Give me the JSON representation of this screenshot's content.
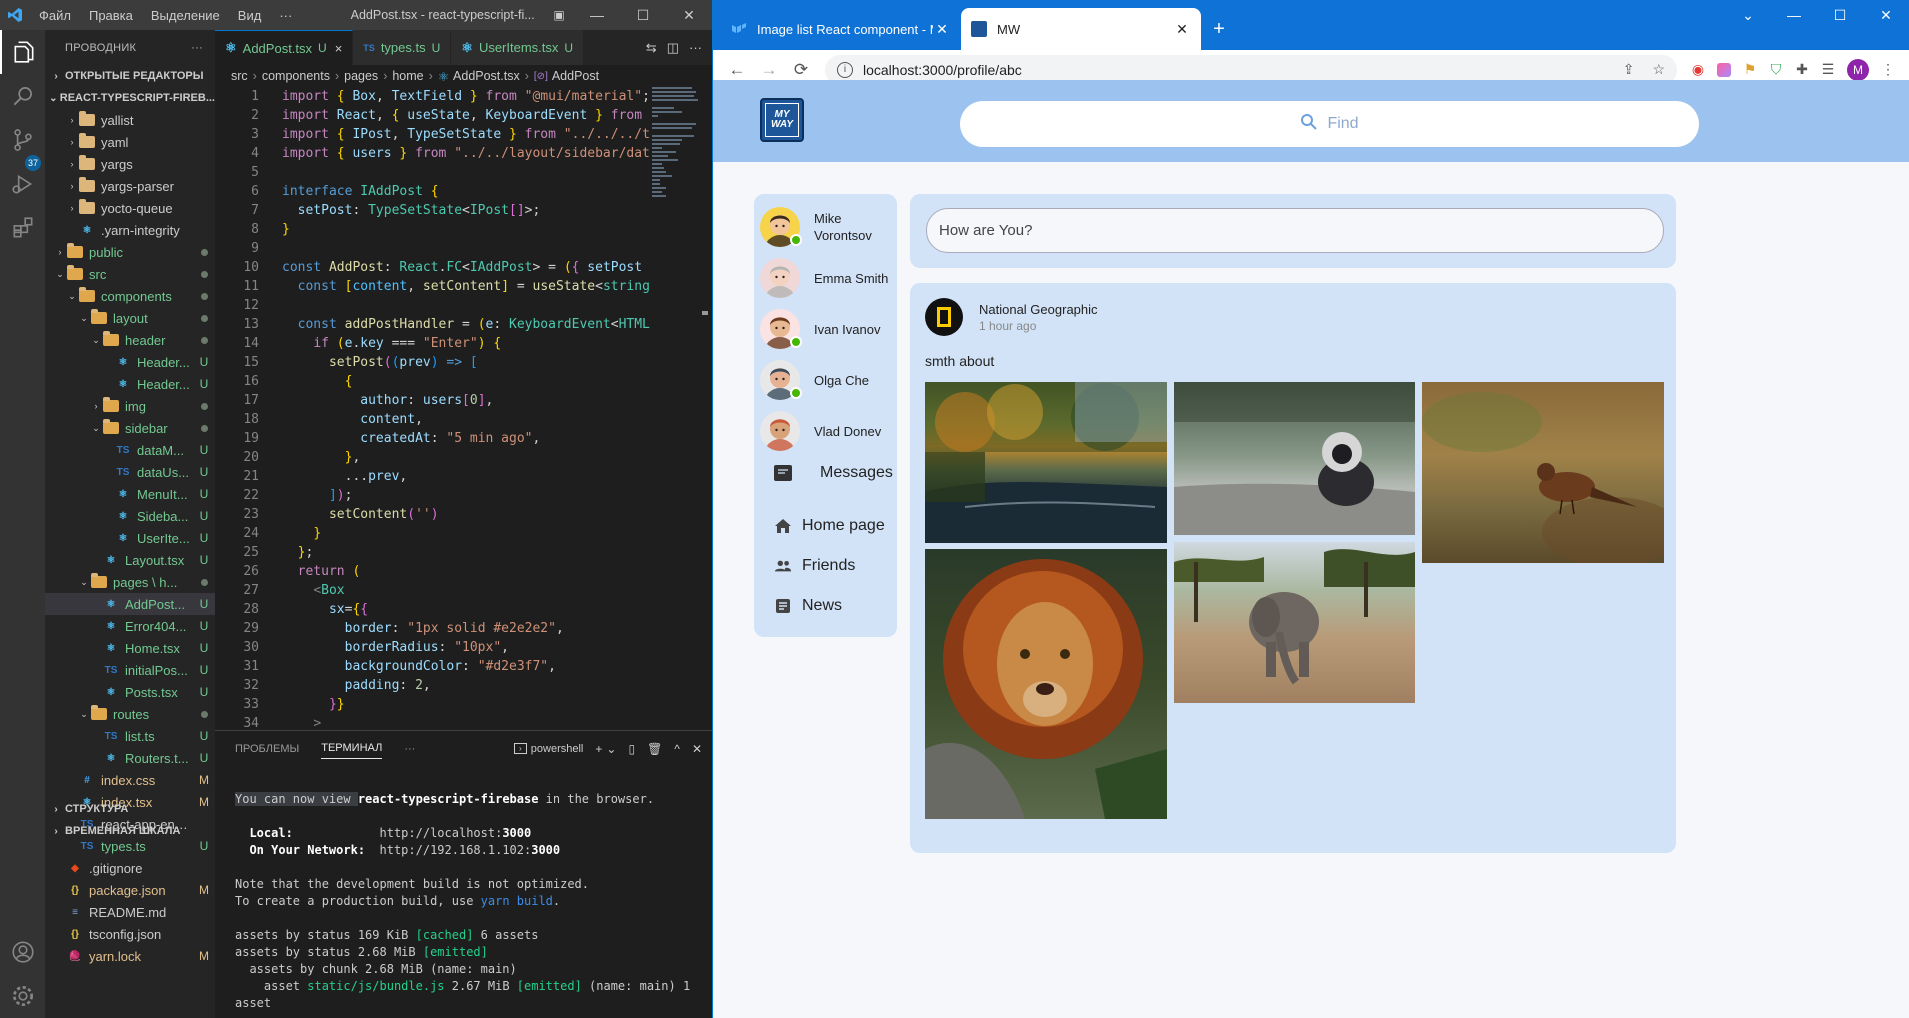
{
  "vscode": {
    "menu": [
      "Файл",
      "Правка",
      "Выделение",
      "Вид",
      "···"
    ],
    "window_title": "AddPost.tsx - react-typescript-fi...",
    "window_buttons": [
      "—",
      "☐",
      "✕"
    ],
    "activity": {
      "scm_badge": "37"
    },
    "explorer": {
      "title": "ПРОВОДНИК",
      "more": "···",
      "open_editors": "ОТКРЫТЫЕ РЕДАКТОРЫ",
      "project": "REACT-TYPESCRIPT-FIREB...",
      "outline": "СТРУКТУРА",
      "timeline": "ВРЕМЕННАЯ ШКАЛА",
      "tree": [
        {
          "name": "yallist",
          "type": "folder",
          "indent": 1,
          "color": "#ccc",
          "status": ""
        },
        {
          "name": "yaml",
          "type": "folder",
          "indent": 1,
          "color": "#ccc",
          "status": ""
        },
        {
          "name": "yargs",
          "type": "folder",
          "indent": 1,
          "color": "#ccc",
          "status": ""
        },
        {
          "name": "yargs-parser",
          "type": "folder",
          "indent": 1,
          "color": "#ccc",
          "status": ""
        },
        {
          "name": "yocto-queue",
          "type": "folder",
          "indent": 1,
          "color": "#ccc",
          "status": ""
        },
        {
          "name": ".yarn-integrity",
          "type": "file",
          "indent": 1,
          "color": "#ccc",
          "status": ""
        },
        {
          "name": "public",
          "type": "folder",
          "indent": 0,
          "color": "#73c991",
          "status": "dot"
        },
        {
          "name": "src",
          "type": "folder",
          "indent": 0,
          "color": "#73c991",
          "status": "dot",
          "open": true
        },
        {
          "name": "components",
          "type": "folder",
          "indent": 1,
          "color": "#73c991",
          "status": "dot",
          "open": true
        },
        {
          "name": "layout",
          "type": "folder",
          "indent": 2,
          "color": "#73c991",
          "status": "dot",
          "open": true
        },
        {
          "name": "header",
          "type": "folder",
          "indent": 3,
          "color": "#73c991",
          "status": "dot",
          "open": true
        },
        {
          "name": "Header...",
          "type": "file",
          "indent": 4,
          "color": "#73c991",
          "status": "U"
        },
        {
          "name": "Header...",
          "type": "file",
          "indent": 4,
          "color": "#73c991",
          "status": "U"
        },
        {
          "name": "img",
          "type": "folder",
          "indent": 3,
          "color": "#73c991",
          "status": "dot"
        },
        {
          "name": "sidebar",
          "type": "folder",
          "indent": 3,
          "color": "#73c991",
          "status": "dot",
          "open": true
        },
        {
          "name": "dataM...",
          "type": "ts",
          "indent": 4,
          "color": "#73c991",
          "status": "U"
        },
        {
          "name": "dataUs...",
          "type": "ts",
          "indent": 4,
          "color": "#73c991",
          "status": "U"
        },
        {
          "name": "MenuIt...",
          "type": "file",
          "indent": 4,
          "color": "#73c991",
          "status": "U"
        },
        {
          "name": "Sideba...",
          "type": "file",
          "indent": 4,
          "color": "#73c991",
          "status": "U"
        },
        {
          "name": "UserIte...",
          "type": "file",
          "indent": 4,
          "color": "#73c991",
          "status": "U"
        },
        {
          "name": "Layout.tsx",
          "type": "file",
          "indent": 3,
          "color": "#73c991",
          "status": "U"
        },
        {
          "name": "pages \\ h...",
          "type": "folder",
          "indent": 2,
          "color": "#73c991",
          "status": "dot",
          "open": true
        },
        {
          "name": "AddPost...",
          "type": "file",
          "indent": 3,
          "color": "#73c991",
          "status": "U",
          "selected": true
        },
        {
          "name": "Error404...",
          "type": "file",
          "indent": 3,
          "color": "#73c991",
          "status": "U"
        },
        {
          "name": "Home.tsx",
          "type": "file",
          "indent": 3,
          "color": "#73c991",
          "status": "U"
        },
        {
          "name": "initialPos...",
          "type": "ts",
          "indent": 3,
          "color": "#73c991",
          "status": "U"
        },
        {
          "name": "Posts.tsx",
          "type": "file",
          "indent": 3,
          "color": "#73c991",
          "status": "U"
        },
        {
          "name": "routes",
          "type": "folder",
          "indent": 2,
          "color": "#73c991",
          "status": "dot",
          "open": true
        },
        {
          "name": "list.ts",
          "type": "ts",
          "indent": 3,
          "color": "#73c991",
          "status": "U"
        },
        {
          "name": "Routers.t...",
          "type": "file",
          "indent": 3,
          "color": "#73c991",
          "status": "U"
        },
        {
          "name": "index.css",
          "type": "css",
          "indent": 1,
          "color": "#e2c08d",
          "status": "M"
        },
        {
          "name": "index.tsx",
          "type": "file",
          "indent": 1,
          "color": "#e2c08d",
          "status": "M"
        },
        {
          "name": "react-app-env.d.ts",
          "type": "ts",
          "indent": 1,
          "color": "#ccc",
          "status": ""
        },
        {
          "name": "types.ts",
          "type": "ts",
          "indent": 1,
          "color": "#73c991",
          "status": "U"
        },
        {
          "name": ".gitignore",
          "type": "git",
          "indent": 0,
          "color": "#ccc",
          "status": ""
        },
        {
          "name": "package.json",
          "type": "json",
          "indent": 0,
          "color": "#e2c08d",
          "status": "M"
        },
        {
          "name": "README.md",
          "type": "md",
          "indent": 0,
          "color": "#ccc",
          "status": ""
        },
        {
          "name": "tsconfig.json",
          "type": "json",
          "indent": 0,
          "color": "#ccc",
          "status": ""
        },
        {
          "name": "yarn.lock",
          "type": "yarn",
          "indent": 0,
          "color": "#e2c08d",
          "status": "M"
        }
      ]
    },
    "tabs": [
      {
        "icon": "react",
        "name": "AddPost.tsx",
        "status": "U",
        "close": "×",
        "active": true
      },
      {
        "icon": "TS",
        "name": "types.ts",
        "status": "U",
        "close": "",
        "active": false
      },
      {
        "icon": "react",
        "name": "UserItems.tsx",
        "status": "U",
        "close": "",
        "active": false
      }
    ],
    "breadcrumb": [
      "src",
      "components",
      "pages",
      "home",
      "AddPost.tsx",
      "AddPost"
    ],
    "breadcrumb_sym": "[⊘]",
    "code_lines": [
      {
        "n": "1",
        "html": "<span class='kw'>import</span> <span class='br1'>{</span> <span class='vr'>Box</span>, <span class='vr'>TextField</span> <span class='br1'>}</span> <span class='kw'>from</span> <span class='str'>\"@mui/material\"</span>;"
      },
      {
        "n": "2",
        "html": "<span class='kw'>import</span> <span class='vr'>React</span>, <span class='br1'>{</span> <span class='vr'>useState</span>, <span class='vr'>KeyboardEvent</span> <span class='br1'>}</span> <span class='kw'>from</span>"
      },
      {
        "n": "3",
        "html": "<span class='kw'>import</span> <span class='br1'>{</span> <span class='vr'>IPost</span>, <span class='vr'>TypeSetState</span> <span class='br1'>}</span> <span class='kw'>from</span> <span class='str'>\"../../../t</span>"
      },
      {
        "n": "4",
        "html": "<span class='kw'>import</span> <span class='br1'>{</span> <span class='vr'>users</span> <span class='br1'>}</span> <span class='kw'>from</span> <span class='str'>\"../../layout/sidebar/dat</span>"
      },
      {
        "n": "5",
        "html": ""
      },
      {
        "n": "6",
        "html": "<span class='kb'>interface</span> <span class='ty'>IAddPost</span> <span class='br1'>{</span>"
      },
      {
        "n": "7",
        "html": "  <span class='vr'>setPost</span>: <span class='ty'>TypeSetState</span>&lt;<span class='ty'>IPost</span><span class='br2'>[]</span>&gt;;"
      },
      {
        "n": "8",
        "html": "<span class='br1'>}</span>"
      },
      {
        "n": "9",
        "html": ""
      },
      {
        "n": "10",
        "html": "<span class='kb'>const</span> <span class='fn'>AddPost</span>: <span class='ty'>React</span>.<span class='ty'>FC</span>&lt;<span class='ty'>IAddPost</span>&gt; = <span class='br1'>(</span><span class='br2'>{</span> <span class='vr'>setPost</span>"
      },
      {
        "n": "11",
        "html": "  <span class='kb'>const</span> <span class='br1'>[</span><span class='cn'>content</span>, <span class='fn'>setContent</span><span class='br1'>]</span> = <span class='fn'>useState</span>&lt;<span class='ty'>string</span>"
      },
      {
        "n": "12",
        "html": ""
      },
      {
        "n": "13",
        "html": "  <span class='kb'>const</span> <span class='fn'>addPostHandler</span> = <span class='br1'>(</span><span class='vr'>e</span>: <span class='ty'>KeyboardEvent</span>&lt;<span class='ty'>HTML</span>"
      },
      {
        "n": "14",
        "html": "    <span class='kw'>if</span> <span class='br1'>(</span><span class='vr'>e</span>.<span class='vr'>key</span> === <span class='str'>\"Enter\"</span><span class='br1'>)</span> <span class='br1'>{</span>"
      },
      {
        "n": "15",
        "html": "      <span class='fn'>setPost</span><span class='br2'>(</span><span class='br3'>(</span><span class='vr'>prev</span><span class='br3'>)</span> <span class='kb'>=&gt;</span> <span class='br3'>[</span>"
      },
      {
        "n": "16",
        "html": "        <span class='br1'>{</span>"
      },
      {
        "n": "17",
        "html": "          <span class='vr'>author</span>: <span class='vr'>users</span><span class='br2'>[</span><span class='str' style='color:#b5cea8'>0</span><span class='br2'>]</span>,"
      },
      {
        "n": "18",
        "html": "          <span class='vr'>content</span>,"
      },
      {
        "n": "19",
        "html": "          <span class='vr'>createdAt</span>: <span class='str'>\"5 min ago\"</span>,"
      },
      {
        "n": "20",
        "html": "        <span class='br1'>}</span>,"
      },
      {
        "n": "21",
        "html": "        ...<span class='vr'>prev</span>,"
      },
      {
        "n": "22",
        "html": "      <span class='br3'>]</span><span class='br2'>)</span>;"
      },
      {
        "n": "23",
        "html": "      <span class='fn'>setContent</span><span class='br2'>(</span><span class='str'>''</span><span class='br2'>)</span>"
      },
      {
        "n": "24",
        "html": "    <span class='br1'>}</span>"
      },
      {
        "n": "25",
        "html": "  <span class='br1'>}</span>;"
      },
      {
        "n": "26",
        "html": "  <span class='kw'>return</span> <span class='br1'>(</span>"
      },
      {
        "n": "27",
        "html": "    <span class='pn'>&lt;</span><span class='tg'>Box</span>"
      },
      {
        "n": "28",
        "html": "      <span class='vr'>sx</span>=<span class='br1'>{</span><span class='br2'>{</span>"
      },
      {
        "n": "29",
        "html": "        <span class='vr'>border</span>: <span class='str'>\"1px solid #e2e2e2\"</span>,"
      },
      {
        "n": "30",
        "html": "        <span class='vr'>borderRadius</span>: <span class='str'>\"10px\"</span>,"
      },
      {
        "n": "31",
        "html": "        <span class='vr'>backgroundColor</span>: <span class='str'>\"#d2e3f7\"</span>,"
      },
      {
        "n": "32",
        "html": "        <span class='vr'>padding</span>: <span class='str' style='color:#b5cea8'>2</span>,"
      },
      {
        "n": "33",
        "html": "      <span class='br2'>}</span><span class='br1'>}</span>"
      },
      {
        "n": "34",
        "html": "    <span class='pn'>&gt;</span>"
      }
    ],
    "panel": {
      "tabs": [
        "ПРОБЛЕМЫ",
        "ТЕРМИНАЛ",
        "···"
      ],
      "shell": "powershell",
      "actions": [
        "+",
        "⌄",
        "▯",
        "🗑",
        "^",
        "✕"
      ]
    },
    "terminal": [
      {
        "html": ""
      },
      {
        "html": "<span class='t-hl'>You can now view </span><b>react-typescript-firebase</b> in the browser."
      },
      {
        "html": ""
      },
      {
        "html": "  <b>Local:</b>            http://localhost:<b>3000</b>"
      },
      {
        "html": "  <b>On Your Network:</b>  http://192.168.1.102:<b>3000</b>"
      },
      {
        "html": ""
      },
      {
        "html": "Note that the development build is not optimized."
      },
      {
        "html": "To create a production build, use <span class='t-blue'>yarn build</span>."
      },
      {
        "html": ""
      },
      {
        "html": "assets by status 169 KiB <span class='t-green'>[cached]</span> 6 assets"
      },
      {
        "html": "assets by status 2.68 MiB <span class='t-green'>[emitted]</span>"
      },
      {
        "html": "  assets by chunk 2.68 MiB (name: main)"
      },
      {
        "html": "    asset <span class='t-green'>static/js/bundle.js</span> 2.67 MiB <span class='t-green'>[emitted]</span> (name: main) 1"
      },
      {
        "html": "asset"
      }
    ]
  },
  "browser": {
    "tabs": [
      {
        "title": "Image list React component - M",
        "close": "✕",
        "active": false,
        "fav": "mui"
      },
      {
        "title": "MW",
        "close": "✕",
        "active": true,
        "fav": "mw"
      }
    ],
    "new_tab": "+",
    "window_buttons": [
      "⌄",
      "—",
      "☐",
      "✕"
    ],
    "url": "localhost:3000/profile/abc",
    "profile_letter": "M",
    "app": {
      "logo_text_1": "MY",
      "logo_text_2": "WAY",
      "search_placeholder": "Find",
      "users": [
        {
          "name": "Mike Vorontsov",
          "online": true,
          "skin": "#f2c59b",
          "hair": "#3a2a1a",
          "bg": "#f7d34a"
        },
        {
          "name": "Emma Smith",
          "online": false,
          "skin": "#f3d2c1",
          "hair": "#b4b4b4",
          "bg": "#f0d8d8"
        },
        {
          "name": "Ivan Ivanov",
          "online": true,
          "skin": "#e8b892",
          "hair": "#6b3b22",
          "bg": "#fbe3e3"
        },
        {
          "name": "Olga Che",
          "online": true,
          "skin": "#e6b293",
          "hair": "#3a4c5c",
          "bg": "#e8e8e8"
        },
        {
          "name": "Vlad Donev",
          "online": false,
          "skin": "#d9a37a",
          "hair": "#c9583b",
          "bg": "#e8e8e8"
        }
      ],
      "messages_label": "Messages",
      "nav": [
        {
          "label": "Home page",
          "icon": "home-icon"
        },
        {
          "label": "Friends",
          "icon": "friends-icon"
        },
        {
          "label": "News",
          "icon": "news-icon"
        }
      ],
      "post_input_placeholder": "How are You?",
      "post": {
        "author": "National Geographic",
        "time": "1 hour ago",
        "text": "smth about"
      }
    }
  }
}
